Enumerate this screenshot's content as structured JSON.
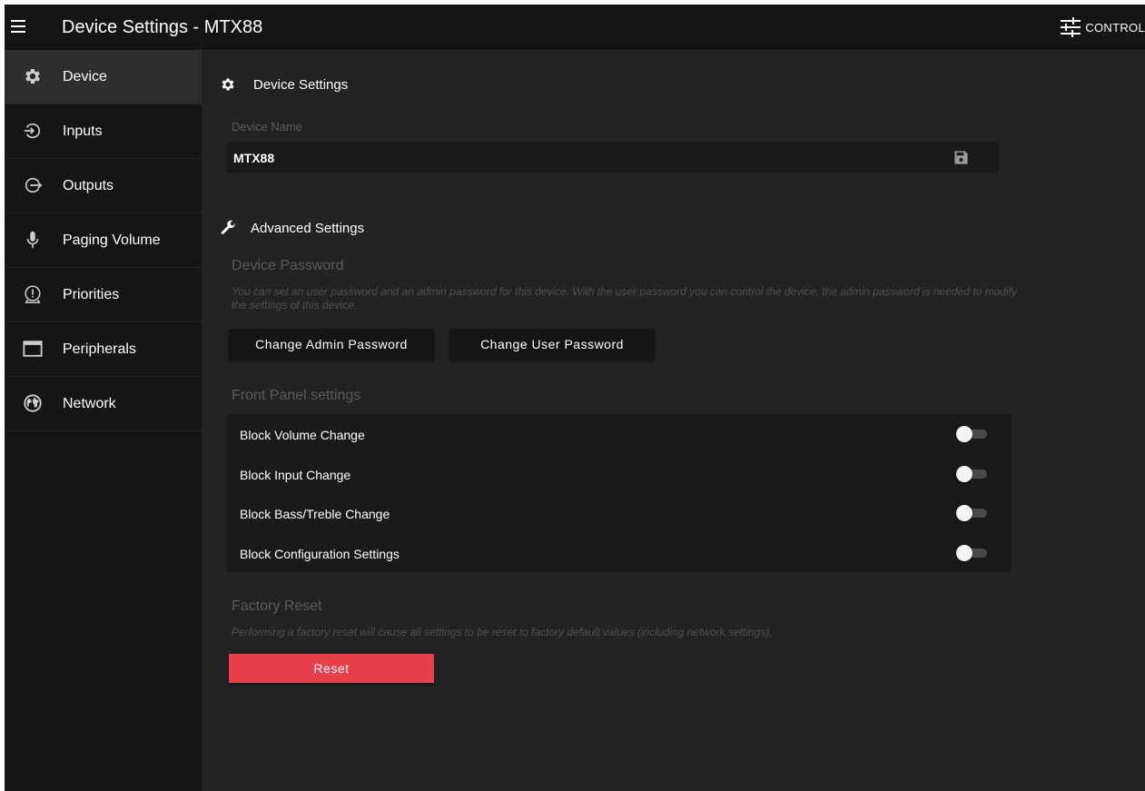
{
  "topbar": {
    "menu_icon": "hamburger-menu-icon",
    "title": "Device Settings - MTX88",
    "control_icon": "sliders-icon",
    "control_label": "CONTROL"
  },
  "sidebar": {
    "items": [
      {
        "label": "Device",
        "icon": "gear-icon",
        "active": true
      },
      {
        "label": "Inputs",
        "icon": "input-arrow-icon",
        "active": false
      },
      {
        "label": "Outputs",
        "icon": "output-arrow-icon",
        "active": false
      },
      {
        "label": "Paging Volume",
        "icon": "microphone-icon",
        "active": false
      },
      {
        "label": "Priorities",
        "icon": "alert-circle-icon",
        "active": false
      },
      {
        "label": "Peripherals",
        "icon": "window-icon",
        "active": false
      },
      {
        "label": "Network",
        "icon": "globe-icon",
        "active": false
      }
    ]
  },
  "device_settings": {
    "title": "Device Settings",
    "icon": "gear-icon",
    "name_label": "Device Name",
    "name_value": "MTX88",
    "save_icon": "floppy-disk-icon"
  },
  "advanced_settings": {
    "title": "Advanced Settings",
    "icon": "wrench-icon",
    "password": {
      "heading": "Device Password",
      "description": "You can set an user password and an admin password for this device. With the user password you can control the device, the admin password is needed to modify the settings of this device.",
      "admin_button": "Change Admin Password",
      "user_button": "Change User Password"
    },
    "front_panel": {
      "heading": "Front Panel settings",
      "toggles": [
        {
          "label": "Block Volume Change",
          "enabled": false
        },
        {
          "label": "Block Input Change",
          "enabled": false
        },
        {
          "label": "Block Bass/Treble Change",
          "enabled": false
        },
        {
          "label": "Block Configuration Settings",
          "enabled": false
        }
      ]
    },
    "factory_reset": {
      "heading": "Factory Reset",
      "description": "Performing a factory reset will cause all settings to be reset to factory default values (including network settings).",
      "reset_button": "Reset"
    }
  },
  "colors": {
    "background": "#232325",
    "topbar": "#141414",
    "sidebar": "#151515",
    "sidebar_active": "#2e2e30",
    "reset_red": "#e8404a"
  }
}
